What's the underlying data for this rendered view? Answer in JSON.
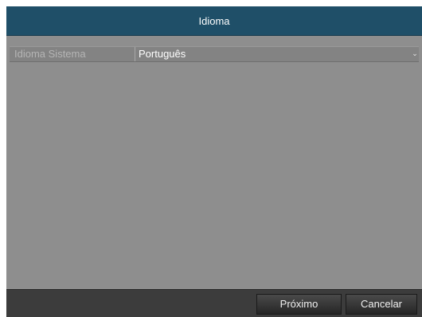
{
  "dialog": {
    "title": "Idioma"
  },
  "settings": {
    "system_language_label": "Idioma Sistema",
    "system_language_value": "Português",
    "dropdown_icon": "chevron-down-icon"
  },
  "footer": {
    "next_label": "Próximo",
    "cancel_label": "Cancelar"
  },
  "colors": {
    "title_bar": "#1f4f68",
    "body": "#8e8e8e",
    "footer": "#3c3c3c"
  }
}
